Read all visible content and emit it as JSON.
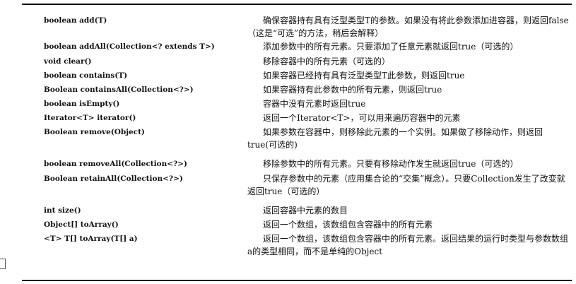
{
  "methods": [
    {
      "signature": "boolean add(T)",
      "description": "确保容器持有具有泛型类型T的参数。如果没有将此参数添加进容器，则返回false（这是“可选”的方法，稍后会解释）"
    },
    {
      "signature": "boolean addAll(Collection<? extends T>)",
      "description": "添加参数中的所有元素。只要添加了任意元素就返回true（可选的）"
    },
    {
      "signature": "void clear()",
      "description": "移除容器中的所有元素（可选的）"
    },
    {
      "signature": "boolean contains(T)",
      "description": "如果容器已经持有具有泛型类型T此参数，则返回true"
    },
    {
      "signature": "Boolean containsAll(Collection<?>)",
      "description": "如果容器持有此参数中的所有元素，则返回true"
    },
    {
      "signature": "boolean isEmpty()",
      "description": "容器中没有元素时返回true"
    },
    {
      "signature": "Iterator<T> iterator()",
      "description": "返回一个Iterator<T>，可以用来遍历容器中的元素"
    },
    {
      "signature": "Boolean remove(Object)",
      "description": "如果参数在容器中，则移除此元素的一个实例。如果做了移除动作，则返回true(可选的)"
    },
    {
      "signature": "boolean removeAll(Collection<?>)",
      "description": "移除参数中的所有元素。只要有移除动作发生就返回true（可选的）"
    },
    {
      "signature": "Boolean retainAll(Collection<?>)",
      "description": "只保存参数中的元素（应用集合论的“交集”概念）。只要Collection发生了改变就返回true（可选的）"
    },
    {
      "signature": "int size()",
      "description": "返回容器中元素的数目"
    },
    {
      "signature": "Object[] toArray()",
      "description": "返回一个数组，该数组包含容器中的所有元素"
    },
    {
      "signature": "<T> T[] toArray(T[] a)",
      "description": "返回一个数组，该数组包含容器中的所有元素。返回结果的运行时类型与参数数组a的类型相同，而不是单纯的Object"
    }
  ]
}
